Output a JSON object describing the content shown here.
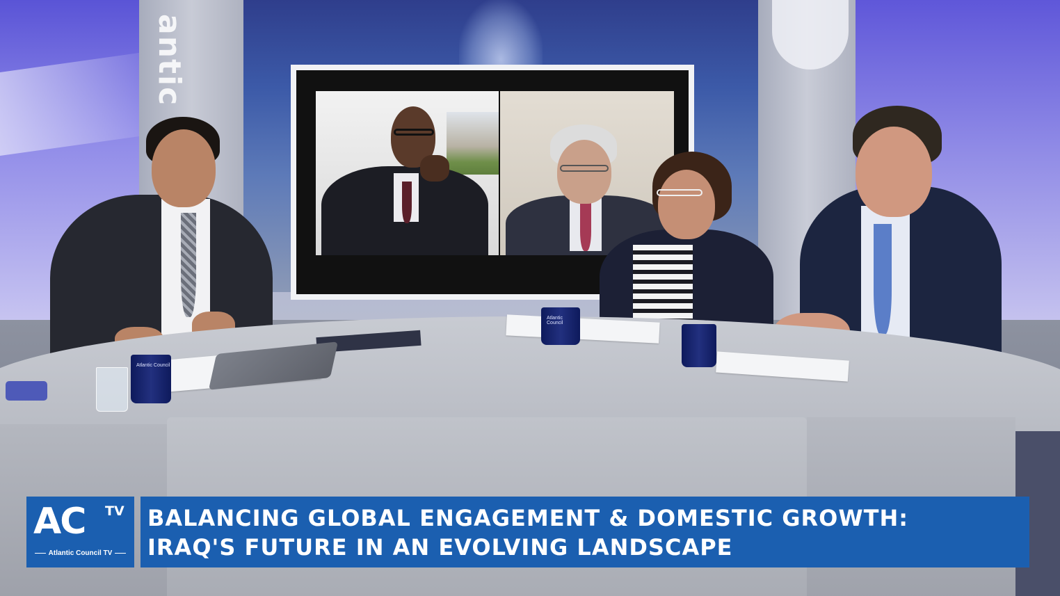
{
  "studio": {
    "wall_lettering": "antic C",
    "mug_label": "Atlantic Council"
  },
  "lower_third": {
    "logo_ac": "AC",
    "logo_tv": "TV",
    "logo_subtitle": "Atlantic Council TV",
    "title_line1": "BALANCING GLOBAL ENGAGEMENT & DOMESTIC GROWTH:",
    "title_line2": "IRAQ'S FUTURE IN AN EVOLVING LANDSCAPE"
  },
  "colors": {
    "lower_third_blue": "#1b5fb0",
    "mug_navy": "#16236b",
    "wall_purple": "#6c66dc"
  },
  "icons": [
    "atlantic-council-globe-icon"
  ]
}
